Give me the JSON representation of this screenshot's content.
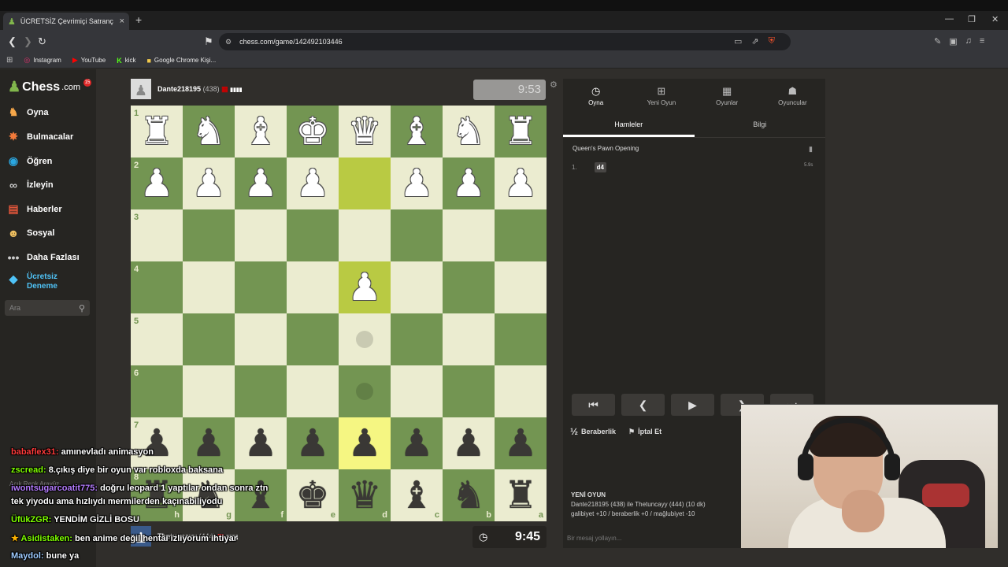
{
  "browser": {
    "tab_title": "ÜCRETSİZ Çevrimiçi Satranç Oyna",
    "url": "chess.com/game/142492103446",
    "bookmarks": [
      {
        "label": "Instagram",
        "icon": "instagram-icon"
      },
      {
        "label": "YouTube",
        "icon": "youtube-icon"
      },
      {
        "label": "kick",
        "icon": "kick-icon"
      },
      {
        "label": "Google Chrome Kişi...",
        "icon": "folder-icon"
      }
    ]
  },
  "sidebar": {
    "logo": "Chess",
    "logo_suffix": ".com",
    "notification_count": "15",
    "items": [
      {
        "label": "Oyna",
        "icon": "play-icon",
        "color": "#f7a84a"
      },
      {
        "label": "Bulmacalar",
        "icon": "puzzle-icon",
        "color": "#f27a3a"
      },
      {
        "label": "Öğren",
        "icon": "learn-icon",
        "color": "#2aa6e0"
      },
      {
        "label": "İzleyin",
        "icon": "binoculars-icon",
        "color": "#cccccc"
      },
      {
        "label": "Haberler",
        "icon": "news-icon",
        "color": "#e0553a"
      },
      {
        "label": "Sosyal",
        "icon": "social-icon",
        "color": "#f0c060"
      },
      {
        "label": "Daha Fazlası",
        "icon": "more-icon",
        "color": "#cccccc"
      },
      {
        "label": "Ücretsiz Deneme",
        "icon": "diamond-icon",
        "color": "#4fc3f7"
      }
    ],
    "search_placeholder": "Ara",
    "theme_label": "Açık Renk Arayüz"
  },
  "game": {
    "top_player": {
      "name": "Dante218195",
      "rating": "(438)",
      "clock": "9:53"
    },
    "bottom_player": {
      "name": "Thetuncayy",
      "rating": "(444)",
      "clock": "9:45"
    },
    "board": [
      [
        "wR",
        "wN",
        "wB",
        "wK",
        "wQ",
        "wB",
        "wN",
        "wR"
      ],
      [
        "wP",
        "wP",
        "wP",
        "wP",
        "",
        "wP",
        "wP",
        "wP"
      ],
      [
        "",
        "",
        "",
        "",
        "",
        "",
        "",
        ""
      ],
      [
        "",
        "",
        "",
        "",
        "wP",
        "",
        "",
        ""
      ],
      [
        "",
        "",
        "",
        "",
        "",
        "",
        "",
        ""
      ],
      [
        "",
        "",
        "",
        "",
        "",
        "",
        "",
        ""
      ],
      [
        "bP",
        "bP",
        "bP",
        "bP",
        "bP",
        "bP",
        "bP",
        "bP"
      ],
      [
        "bR",
        "bN",
        "bB",
        "bK",
        "bQ",
        "bB",
        "bN",
        "bR"
      ]
    ],
    "ranks": [
      "1",
      "2",
      "3",
      "4",
      "5",
      "6",
      "7",
      "8"
    ],
    "files": [
      "h",
      "g",
      "f",
      "e",
      "d",
      "c",
      "b",
      "a"
    ]
  },
  "panel": {
    "tabs": [
      {
        "label": "Oyna",
        "icon": "clock-icon"
      },
      {
        "label": "Yeni Oyun",
        "icon": "plus-icon"
      },
      {
        "label": "Oyunlar",
        "icon": "board-icon"
      },
      {
        "label": "Oyuncular",
        "icon": "players-icon"
      }
    ],
    "subtabs": [
      "Hamleler",
      "Bilgi"
    ],
    "opening": "Queen's Pawn Opening",
    "moves": [
      {
        "num": "1.",
        "white": "d4"
      }
    ],
    "move_time": "5.9s",
    "draw_label": "Beraberlik",
    "draw_symbol": "½",
    "resign_label": "İptal Et",
    "new_game_title": "YENİ OYUN",
    "new_game_players": "Dante218195 (438) ile Thetuncayy (444) (10 dk)",
    "new_game_stakes": "galibiyet +10 / beraberlik +0 / mağlubiyet -10",
    "message_placeholder": "Bir mesaj yollayın..."
  },
  "chat": [
    {
      "user": "babaflex31:",
      "text": "amınevladı animasyon",
      "color": "#ff3b3b"
    },
    {
      "user": "zscread:",
      "text": "8.çıkış diye bir oyun var robloxda baksana",
      "color": "#7fff00"
    },
    {
      "user": "iwontsugarcoatit775:",
      "text": "doğru leopard 1 yaptılar ondan sonra ztn",
      "color": "#b57cff"
    },
    {
      "user": "",
      "text": "tek yiyodu ama hızlıydı mermilerden kaçınabiliyodu",
      "color": "#ffffff"
    },
    {
      "user": "ÜfükZGR:",
      "text": "YENDİM GİZLİ BOSU",
      "color": "#7fff00"
    },
    {
      "user": "Asidistaken:",
      "text": "ben anime değil hentai izliyorum ihtiyar",
      "color": "#7fff00"
    },
    {
      "user": "Maydol:",
      "text": "bune ya",
      "color": "#9ecbff"
    }
  ]
}
